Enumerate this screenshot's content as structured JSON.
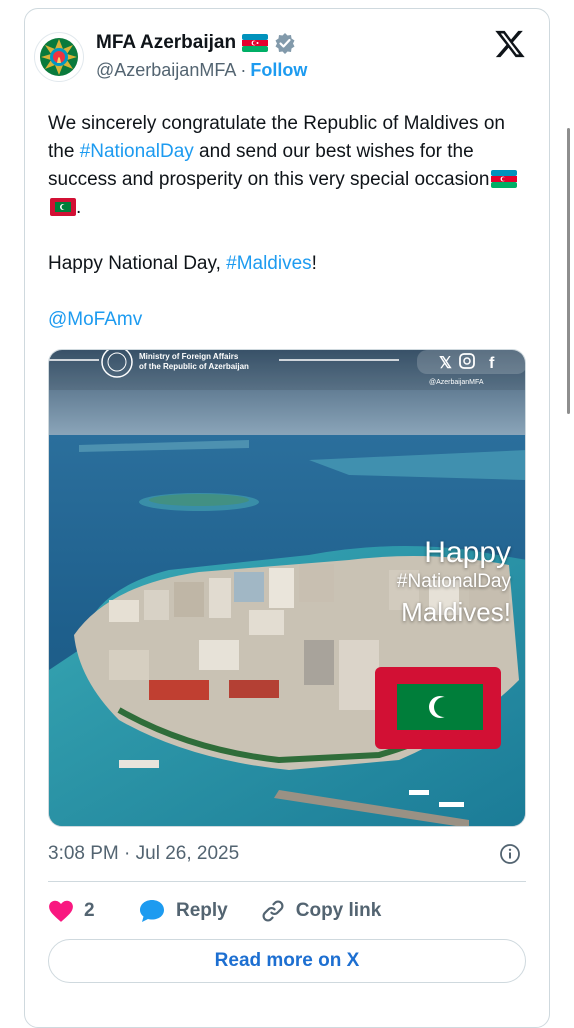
{
  "tweet": {
    "author_name": "MFA Azerbaijan",
    "author_flag": "🇦🇿",
    "handle": "@AzerbaijanMFA",
    "separator": "·",
    "follow_label": "Follow",
    "text": {
      "line1_pre": "We sincerely congratulate the Republic of Maldives on the ",
      "hashtag1": "#NationalDay",
      "line1_post": " and send our best wishes for the success and prosperity on this very special occasion",
      "line1_end": ".",
      "line2_pre": "Happy National Day, ",
      "hashtag2": "#Maldives",
      "line2_post": "!",
      "mention": "@MoFAmv"
    },
    "timestamp": "3:08 PM · Jul 26, 2025"
  },
  "media": {
    "ministry_line1": "Ministry of Foreign Affairs",
    "ministry_line2": "of the Republic of Azerbaijan",
    "social_handle": "@AzerbaijanMFA",
    "greeting1": "Happy",
    "greeting2": "#NationalDay",
    "greeting3": "Maldives!"
  },
  "actions": {
    "like_count": "2",
    "reply_label": "Reply",
    "copy_link_label": "Copy link",
    "read_more_label": "Read more on X"
  },
  "colors": {
    "link": "#1d9bf0",
    "like": "#f91880",
    "verified": "#829aab",
    "maldives_red": "#d21034",
    "maldives_green": "#007e3a"
  }
}
